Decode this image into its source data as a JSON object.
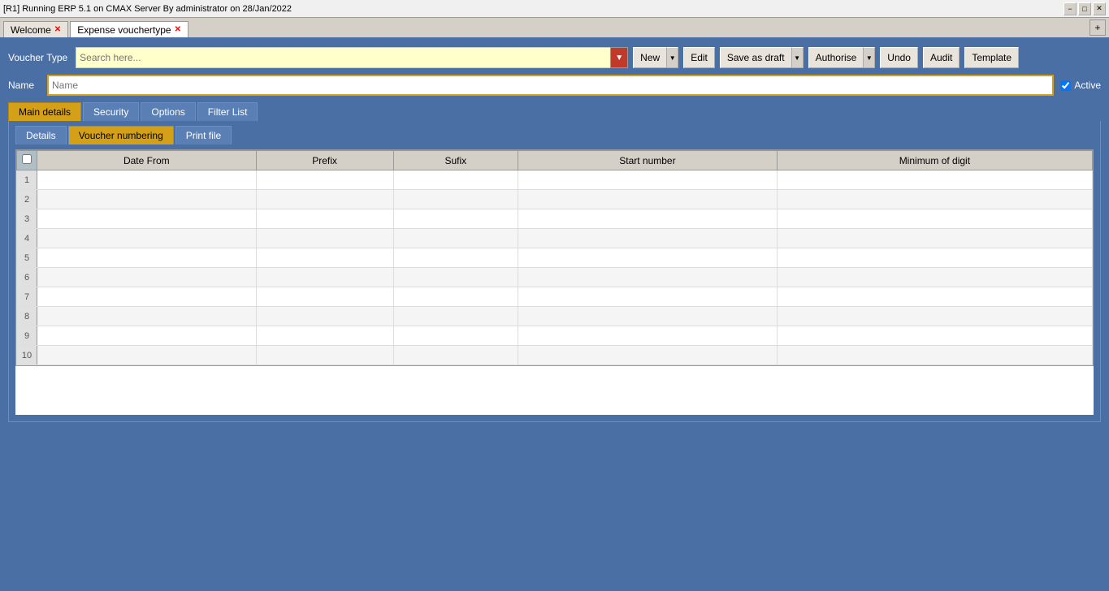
{
  "window": {
    "title": "[R1] Running ERP 5.1 on CMAX Server By administrator on 28/Jan/2022"
  },
  "tabs": [
    {
      "id": "welcome",
      "label": "Welcome",
      "closable": true
    },
    {
      "id": "expense-vouchertype",
      "label": "Expense vouchertype",
      "closable": true,
      "active": true
    }
  ],
  "tab_add_label": "+",
  "toolbar": {
    "voucher_type_label": "Voucher Type",
    "search_placeholder": "Search here...",
    "new_label": "New",
    "edit_label": "Edit",
    "save_as_draft_label": "Save as draft",
    "authorise_label": "Authorise",
    "undo_label": "Undo",
    "audit_label": "Audit",
    "template_label": "Template"
  },
  "name_row": {
    "label": "Name",
    "placeholder": "Name",
    "active_label": "Active",
    "active_checked": true
  },
  "inner_tabs": [
    {
      "id": "main-details",
      "label": "Main details",
      "active": true
    },
    {
      "id": "security",
      "label": "Security"
    },
    {
      "id": "options",
      "label": "Options"
    },
    {
      "id": "filter-list",
      "label": "Filter List"
    }
  ],
  "sub_tabs": [
    {
      "id": "details",
      "label": "Details"
    },
    {
      "id": "voucher-numbering",
      "label": "Voucher numbering",
      "active": true
    },
    {
      "id": "print-file",
      "label": "Print file"
    }
  ],
  "table": {
    "columns": [
      {
        "id": "checkbox",
        "label": "",
        "type": "checkbox"
      },
      {
        "id": "date-from",
        "label": "Date From"
      },
      {
        "id": "prefix",
        "label": "Prefix"
      },
      {
        "id": "sufix",
        "label": "Sufix"
      },
      {
        "id": "start-number",
        "label": "Start number"
      },
      {
        "id": "minimum-of-digit",
        "label": "Minimum of digit"
      }
    ],
    "rows": [
      {
        "num": 1
      },
      {
        "num": 2
      },
      {
        "num": 3
      },
      {
        "num": 4
      },
      {
        "num": 5
      },
      {
        "num": 6
      },
      {
        "num": 7
      },
      {
        "num": 8
      },
      {
        "num": 9
      },
      {
        "num": 10
      }
    ]
  }
}
